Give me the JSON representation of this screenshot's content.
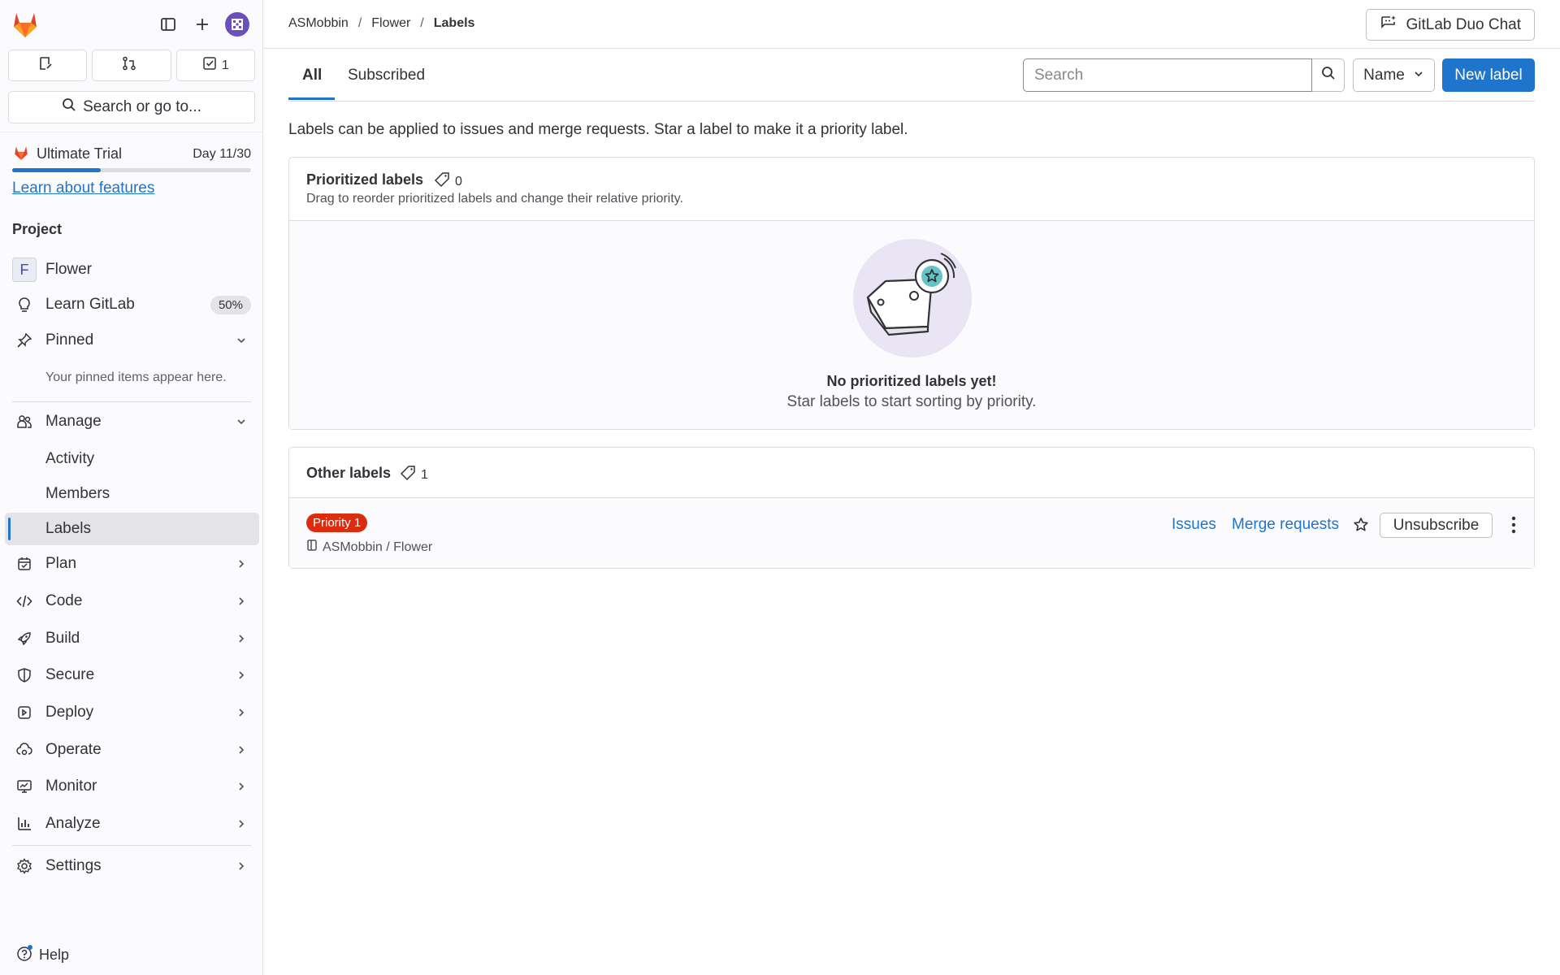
{
  "sidebar": {
    "counters": {
      "issues": "",
      "merge_requests": "",
      "todos": "1"
    },
    "search_label": "Search or go to...",
    "trial": {
      "title": "Ultimate Trial",
      "day": "Day 11/30",
      "progress": 0.37,
      "link": "Learn about features"
    },
    "section": "Project",
    "project": {
      "avatar_letter": "F",
      "name": "Flower"
    },
    "learn": {
      "label": "Learn GitLab",
      "badge": "50%"
    },
    "pinned": {
      "label": "Pinned",
      "hint": "Your pinned items appear here."
    },
    "manage": {
      "label": "Manage",
      "items": [
        "Activity",
        "Members",
        "Labels"
      ]
    },
    "groups": [
      "Plan",
      "Code",
      "Build",
      "Secure",
      "Deploy",
      "Operate",
      "Monitor",
      "Analyze"
    ],
    "settings": "Settings",
    "help": "Help"
  },
  "topbar": {
    "breadcrumbs": [
      "ASMobbin",
      "Flower",
      "Labels"
    ],
    "duo_chat": "GitLab Duo Chat"
  },
  "tabs": [
    "All",
    "Subscribed"
  ],
  "search": {
    "placeholder": "Search"
  },
  "sort": "Name",
  "new_label": "New label",
  "intro": "Labels can be applied to issues and merge requests. Star a label to make it a priority label.",
  "prioritized": {
    "title": "Prioritized labels",
    "count": "0",
    "subtitle": "Drag to reorder prioritized labels and change their relative priority.",
    "empty_title": "No prioritized labels yet!",
    "empty_subtitle": "Star labels to start sorting by priority."
  },
  "other": {
    "title": "Other labels",
    "count": "1",
    "label": {
      "name": "Priority 1",
      "color": "#dd2b0e",
      "path": "ASMobbin / Flower",
      "issues_link": "Issues",
      "mr_link": "Merge requests",
      "unsubscribe": "Unsubscribe"
    }
  },
  "colors": {
    "accent": "#1f75cb",
    "brand": "#fc6d26"
  }
}
